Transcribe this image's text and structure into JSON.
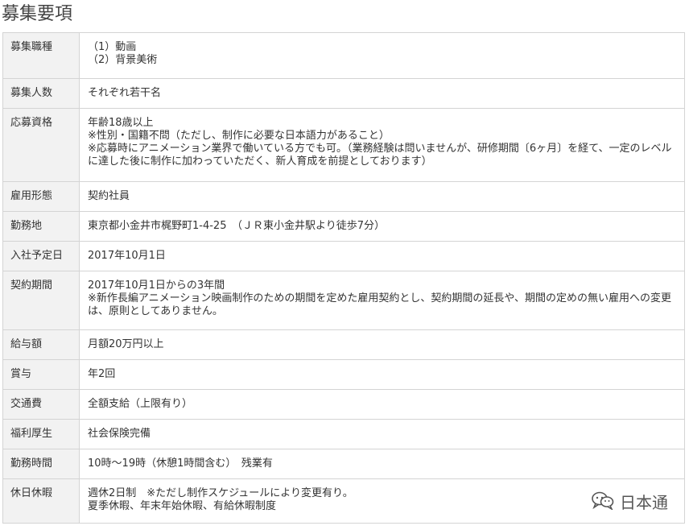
{
  "title": "募集要項",
  "rows": [
    {
      "label": "募集職種",
      "lines": [
        "（1）動画",
        "（2）背景美術"
      ]
    },
    {
      "label": "募集人数",
      "lines": [
        "それぞれ若干名"
      ]
    },
    {
      "label": "応募資格",
      "lines": [
        "年齢18歳以上",
        "※性別・国籍不問（ただし、制作に必要な日本語力があること）",
        "※応募時にアニメーション業界で働いている方でも可。（業務経験は問いませんが、研修期間〔6ヶ月〕を経て、一定のレベルに達した後に制作に加わっていただく、新人育成を前提としております）"
      ]
    },
    {
      "label": "雇用形態",
      "lines": [
        "契約社員"
      ]
    },
    {
      "label": "勤務地",
      "lines": [
        "東京都小金井市梶野町1-4-25　（ＪＲ東小金井駅より徒歩7分）"
      ]
    },
    {
      "label": "入社予定日",
      "lines": [
        "2017年10月1日"
      ]
    },
    {
      "label": "契約期間",
      "lines": [
        "2017年10月1日からの3年間",
        "※新作長編アニメーション映画制作のための期間を定めた雇用契約とし、契約期間の延長や、期間の定めの無い雇用への変更は、原則としてありません。"
      ]
    },
    {
      "label": "給与額",
      "lines": [
        "月額20万円以上"
      ]
    },
    {
      "label": "賞与",
      "lines": [
        "年2回"
      ]
    },
    {
      "label": "交通費",
      "lines": [
        "全額支給（上限有り）"
      ]
    },
    {
      "label": "福利厚生",
      "lines": [
        "社会保険完備"
      ]
    },
    {
      "label": "勤務時間",
      "lines": [
        "10時～19時（休憩1時間含む）　残業有"
      ]
    },
    {
      "label": "休日休暇",
      "lines": [
        "週休2日制　※ただし制作スケジュールにより変更有り。",
        "夏季休暇、年末年始休暇、有給休暇制度"
      ]
    }
  ],
  "watermark": {
    "text": "日本通",
    "icon": "wechat-icon"
  }
}
